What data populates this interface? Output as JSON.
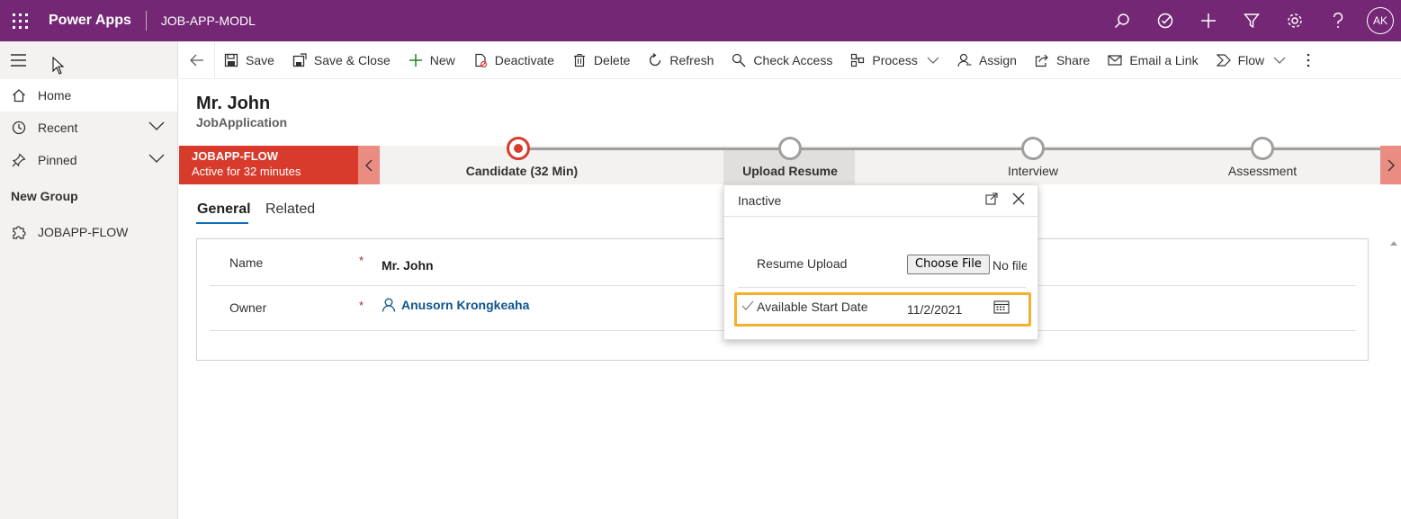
{
  "topbar": {
    "brand": "Power Apps",
    "app_name": "JOB-APP-MODL",
    "avatar_initials": "AK",
    "color": "#742774"
  },
  "sidebar": {
    "items": [
      {
        "label": "Home",
        "icon": "home-icon"
      },
      {
        "label": "Recent",
        "icon": "clock-icon"
      },
      {
        "label": "Pinned",
        "icon": "pin-icon"
      }
    ],
    "group_title": "New Group",
    "group_items": [
      {
        "label": "JOBAPP-FLOW",
        "icon": "puzzle-icon"
      }
    ]
  },
  "commandbar": {
    "save": "Save",
    "save_close": "Save & Close",
    "new": "New",
    "deactivate": "Deactivate",
    "delete": "Delete",
    "refresh": "Refresh",
    "check_access": "Check Access",
    "process": "Process",
    "assign": "Assign",
    "share": "Share",
    "email_link": "Email a Link",
    "flow": "Flow"
  },
  "record": {
    "title": "Mr. John",
    "entity": "JobApplication"
  },
  "bpf": {
    "name": "JOBAPP-FLOW",
    "status": "Active for 32 minutes",
    "accent": "#d83b2b",
    "stages": [
      {
        "label": "Candidate  (32 Min)"
      },
      {
        "label": "Upload Resume"
      },
      {
        "label": "Interview"
      },
      {
        "label": "Assessment"
      }
    ]
  },
  "tabs": {
    "general": "General",
    "related": "Related"
  },
  "form": {
    "name_label": "Name",
    "name_value": "Mr. John",
    "owner_label": "Owner",
    "owner_value": "Anusorn Krongkeaha",
    "required_mark": "*"
  },
  "flyout": {
    "status": "Inactive",
    "resume_label": "Resume Upload",
    "choose_file": "Choose File",
    "no_file": "No file chosen",
    "start_date_label": "Available Start Date",
    "start_date_value": "11/2/2021"
  }
}
